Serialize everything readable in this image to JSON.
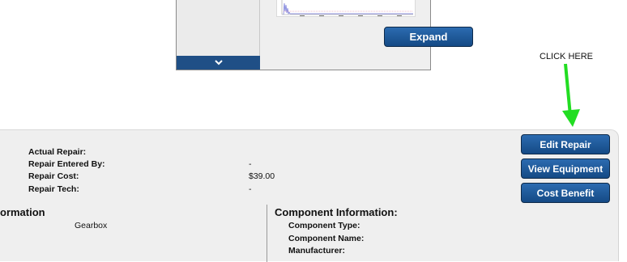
{
  "top_panel": {
    "expand_label": "Expand"
  },
  "annotation": {
    "text": "CLICK HERE",
    "arrow_color": "#22dd22"
  },
  "repair": {
    "actual_repair_label": "Actual Repair:",
    "entered_by_label": "Repair Entered By:",
    "entered_by_value": "-",
    "cost_label": "Repair Cost:",
    "cost_value": "$39.00",
    "tech_label": "Repair Tech:",
    "tech_value": "-"
  },
  "info_section": {
    "title_partial": "ormation",
    "value": "Gearbox"
  },
  "component": {
    "title": "Component Information:",
    "type_label": "Component Type:",
    "name_label": "Component Name:",
    "manufacturer_label": "Manufacturer:"
  },
  "actions": {
    "edit_repair": "Edit Repair",
    "view_equipment": "View Equipment",
    "cost_benefit": "Cost Benefit"
  },
  "colors": {
    "button_top": "#2c6bb0",
    "button_bottom": "#154a85",
    "panel_bg": "#efefef"
  }
}
